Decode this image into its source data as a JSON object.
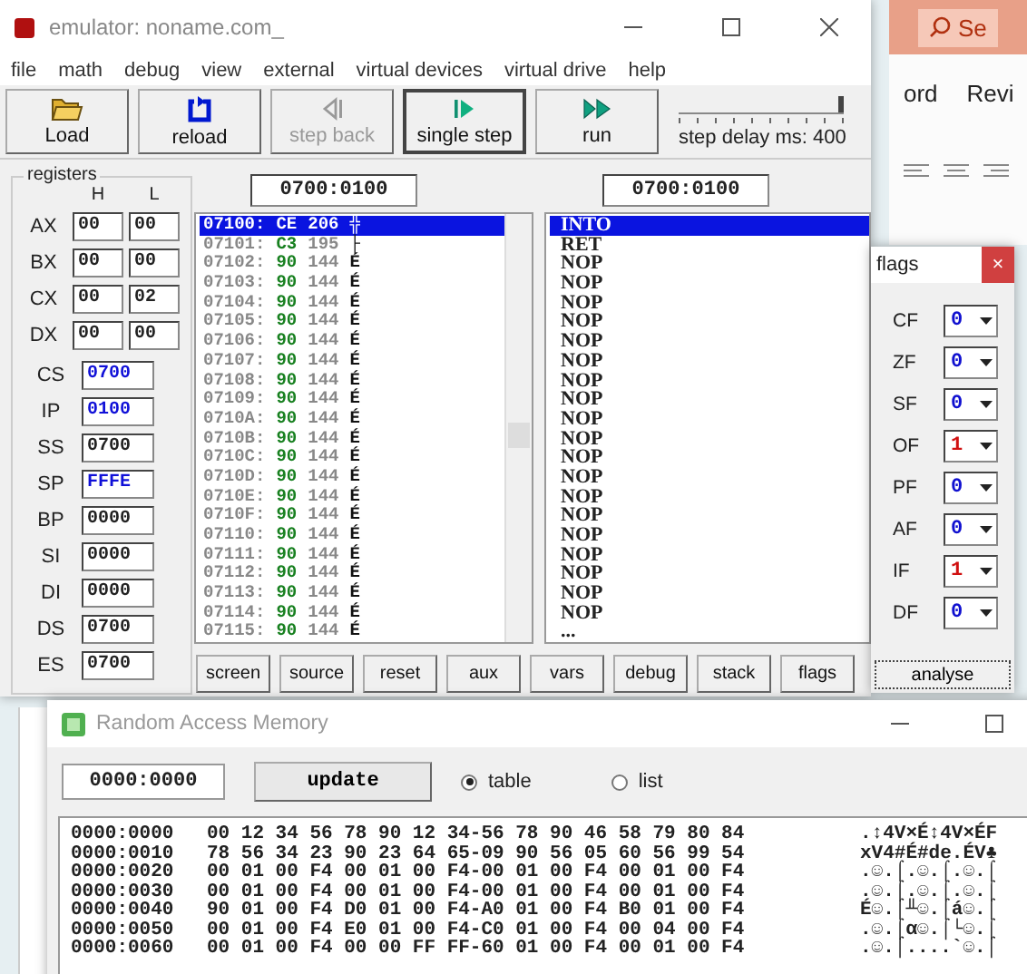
{
  "background": {
    "search": "Se",
    "tabs": [
      "ord",
      "Revi"
    ]
  },
  "emulator": {
    "title": "emulator: noname.com_",
    "menu": [
      "file",
      "math",
      "debug",
      "view",
      "external",
      "virtual devices",
      "virtual drive",
      "help"
    ],
    "toolbar": [
      {
        "kind": "load",
        "label": "Load",
        "disabled": false,
        "focused": false
      },
      {
        "kind": "reload",
        "label": "reload",
        "disabled": false,
        "focused": false
      },
      {
        "kind": "step_back",
        "label": "step back",
        "disabled": true,
        "focused": false
      },
      {
        "kind": "single_step",
        "label": "single step",
        "disabled": false,
        "focused": true
      },
      {
        "kind": "run",
        "label": "run",
        "disabled": false,
        "focused": false
      }
    ],
    "delay": {
      "label": "step delay ms: 400",
      "level": 1
    },
    "registers": {
      "title": "registers",
      "columns": [
        "H",
        "L"
      ],
      "pairs": [
        {
          "name": "AX",
          "h": "00",
          "l": "00"
        },
        {
          "name": "BX",
          "h": "00",
          "l": "00"
        },
        {
          "name": "CX",
          "h": "00",
          "l": "02"
        },
        {
          "name": "DX",
          "h": "00",
          "l": "00"
        }
      ],
      "words": [
        {
          "name": "CS",
          "value": "0700",
          "highlighted": true
        },
        {
          "name": "IP",
          "value": "0100",
          "highlighted": true
        },
        {
          "name": "SS",
          "value": "0700",
          "highlighted": false
        },
        {
          "name": "SP",
          "value": "FFFE",
          "highlighted": true
        },
        {
          "name": "BP",
          "value": "0000",
          "highlighted": false
        },
        {
          "name": "SI",
          "value": "0000",
          "highlighted": false
        },
        {
          "name": "DI",
          "value": "0000",
          "highlighted": false
        },
        {
          "name": "DS",
          "value": "0700",
          "highlighted": false
        },
        {
          "name": "ES",
          "value": "0700",
          "highlighted": false
        }
      ]
    },
    "memory_address": "0700:0100",
    "code_address": "0700:0100",
    "memory_rows": [
      {
        "address": "07100:",
        "hex": "CE",
        "dec": "206",
        "char": "╬",
        "selected": true
      },
      {
        "address": "07101:",
        "hex": "C3",
        "dec": "195",
        "char": "├",
        "selected": false
      },
      {
        "address": "07102:",
        "hex": "90",
        "dec": "144",
        "char": "É",
        "selected": false
      },
      {
        "address": "07103:",
        "hex": "90",
        "dec": "144",
        "char": "É",
        "selected": false
      },
      {
        "address": "07104:",
        "hex": "90",
        "dec": "144",
        "char": "É",
        "selected": false
      },
      {
        "address": "07105:",
        "hex": "90",
        "dec": "144",
        "char": "É",
        "selected": false
      },
      {
        "address": "07106:",
        "hex": "90",
        "dec": "144",
        "char": "É",
        "selected": false
      },
      {
        "address": "07107:",
        "hex": "90",
        "dec": "144",
        "char": "É",
        "selected": false
      },
      {
        "address": "07108:",
        "hex": "90",
        "dec": "144",
        "char": "É",
        "selected": false
      },
      {
        "address": "07109:",
        "hex": "90",
        "dec": "144",
        "char": "É",
        "selected": false
      },
      {
        "address": "0710A:",
        "hex": "90",
        "dec": "144",
        "char": "É",
        "selected": false
      },
      {
        "address": "0710B:",
        "hex": "90",
        "dec": "144",
        "char": "É",
        "selected": false
      },
      {
        "address": "0710C:",
        "hex": "90",
        "dec": "144",
        "char": "É",
        "selected": false
      },
      {
        "address": "0710D:",
        "hex": "90",
        "dec": "144",
        "char": "É",
        "selected": false
      },
      {
        "address": "0710E:",
        "hex": "90",
        "dec": "144",
        "char": "É",
        "selected": false
      },
      {
        "address": "0710F:",
        "hex": "90",
        "dec": "144",
        "char": "É",
        "selected": false
      },
      {
        "address": "07110:",
        "hex": "90",
        "dec": "144",
        "char": "É",
        "selected": false
      },
      {
        "address": "07111:",
        "hex": "90",
        "dec": "144",
        "char": "É",
        "selected": false
      },
      {
        "address": "07112:",
        "hex": "90",
        "dec": "144",
        "char": "É",
        "selected": false
      },
      {
        "address": "07113:",
        "hex": "90",
        "dec": "144",
        "char": "É",
        "selected": false
      },
      {
        "address": "07114:",
        "hex": "90",
        "dec": "144",
        "char": "É",
        "selected": false
      },
      {
        "address": "07115:",
        "hex": "90",
        "dec": "144",
        "char": "É",
        "selected": false
      }
    ],
    "disassembly": [
      {
        "text": "INTO",
        "selected": true
      },
      {
        "text": "RET",
        "selected": false
      },
      {
        "text": "NOP",
        "selected": false
      },
      {
        "text": "NOP",
        "selected": false
      },
      {
        "text": "NOP",
        "selected": false
      },
      {
        "text": "NOP",
        "selected": false
      },
      {
        "text": "NOP",
        "selected": false
      },
      {
        "text": "NOP",
        "selected": false
      },
      {
        "text": "NOP",
        "selected": false
      },
      {
        "text": "NOP",
        "selected": false
      },
      {
        "text": "NOP",
        "selected": false
      },
      {
        "text": "NOP",
        "selected": false
      },
      {
        "text": "NOP",
        "selected": false
      },
      {
        "text": "NOP",
        "selected": false
      },
      {
        "text": "NOP",
        "selected": false
      },
      {
        "text": "NOP",
        "selected": false
      },
      {
        "text": "NOP",
        "selected": false
      },
      {
        "text": "NOP",
        "selected": false
      },
      {
        "text": "NOP",
        "selected": false
      },
      {
        "text": "NOP",
        "selected": false
      },
      {
        "text": "NOP",
        "selected": false
      },
      {
        "text": "...",
        "selected": false
      }
    ],
    "buttons": [
      "screen",
      "source",
      "reset",
      "aux",
      "vars",
      "debug",
      "stack",
      "flags"
    ]
  },
  "flags": {
    "title": "flags",
    "close": "×",
    "items": [
      {
        "name": "CF",
        "value": "0"
      },
      {
        "name": "ZF",
        "value": "0"
      },
      {
        "name": "SF",
        "value": "0"
      },
      {
        "name": "OF",
        "value": "1"
      },
      {
        "name": "PF",
        "value": "0"
      },
      {
        "name": "AF",
        "value": "0"
      },
      {
        "name": "IF",
        "value": "1"
      },
      {
        "name": "DF",
        "value": "0"
      }
    ],
    "button": "analyse"
  },
  "ram": {
    "title": "Random Access Memory",
    "address": "0000:0000",
    "update": "update",
    "views": [
      {
        "label": "table",
        "selected": true
      },
      {
        "label": "list",
        "selected": false
      }
    ],
    "rows": [
      {
        "address": "0000:0000",
        "bytes": "00 12 34 56 78 90 12 34-56 78 90 46 58 79 80 84",
        "ascii": ".↕4V×É↕4V×ÉF"
      },
      {
        "address": "0000:0010",
        "bytes": "78 56 34 23 90 23 64 65-09 90 56 05 60 56 99 54",
        "ascii": "xV4#É#de.ÉV♣"
      },
      {
        "address": "0000:0020",
        "bytes": "00 01 00 F4 00 01 00 F4-00 01 00 F4 00 01 00 F4",
        "ascii": ".☺.⌠.☺.⌠.☺.⌠"
      },
      {
        "address": "0000:0030",
        "bytes": "00 01 00 F4 00 01 00 F4-00 01 00 F4 00 01 00 F4",
        "ascii": ".☺.⌠.☺.⌠.☺.⌠"
      },
      {
        "address": "0000:0040",
        "bytes": "90 01 00 F4 D0 01 00 F4-A0 01 00 F4 B0 01 00 F4",
        "ascii": "É☺.⌠╨☺.⌠á☺.⌠"
      },
      {
        "address": "0000:0050",
        "bytes": "00 01 00 F4 E0 01 00 F4-C0 01 00 F4 00 04 00 F4",
        "ascii": ".☺.⌠α☺.⌠└☺.⌠"
      },
      {
        "address": "0000:0060",
        "bytes": "00 01 00 F4 00 00 FF FF-60 01 00 F4 00 01 00 F4",
        "ascii": ".☺.⌠....`☺.⌠"
      }
    ]
  }
}
